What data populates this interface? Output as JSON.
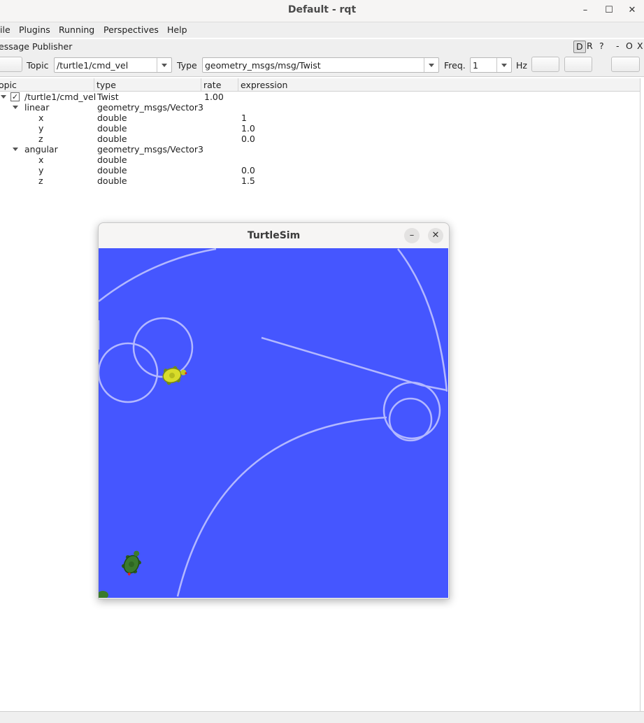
{
  "window": {
    "title": "Default - rqt",
    "minimize": "–",
    "maximize": "☐",
    "close": "✕"
  },
  "menu": [
    "ile",
    "Plugins",
    "Running",
    "Perspectives",
    "Help"
  ],
  "plugin": {
    "title": "essage Publisher",
    "dock_buttons": {
      "d": "D",
      "r": "R",
      "help": "?",
      "minus": "-",
      "o": "O",
      "x": "X"
    }
  },
  "toolbar": {
    "topic_label": "Topic",
    "topic_value": "/turtle1/cmd_vel",
    "type_label": "Type",
    "type_value": "geometry_msgs/msg/Twist",
    "freq_label": "Freq.",
    "freq_value": "1",
    "hz_label": "Hz"
  },
  "tree": {
    "headers": [
      "opic",
      "type",
      "rate",
      "expression"
    ],
    "rows": [
      {
        "topic": "/turtle1/cmd_vel",
        "type": "Twist",
        "rate": "1.00",
        "expression": ""
      },
      {
        "topic": "linear",
        "type": "geometry_msgs/Vector3",
        "rate": "",
        "expression": ""
      },
      {
        "topic": "x",
        "type": "double",
        "rate": "",
        "expression": "1"
      },
      {
        "topic": "y",
        "type": "double",
        "rate": "",
        "expression": "1.0"
      },
      {
        "topic": "z",
        "type": "double",
        "rate": "",
        "expression": "0.0"
      },
      {
        "topic": "angular",
        "type": "geometry_msgs/Vector3",
        "rate": "",
        "expression": ""
      },
      {
        "topic": "x",
        "type": "double",
        "rate": "",
        "expression": ""
      },
      {
        "topic": "y",
        "type": "double",
        "rate": "",
        "expression": "0.0"
      },
      {
        "topic": "z",
        "type": "double",
        "rate": "",
        "expression": "1.5"
      }
    ]
  },
  "turtlesim": {
    "title": "TurtleSim",
    "minimize": "–",
    "close": "✕",
    "background_color": "#4556ff",
    "pen_color": "#b3b8ff"
  },
  "colors": {
    "checkbox_mark": "✓"
  }
}
